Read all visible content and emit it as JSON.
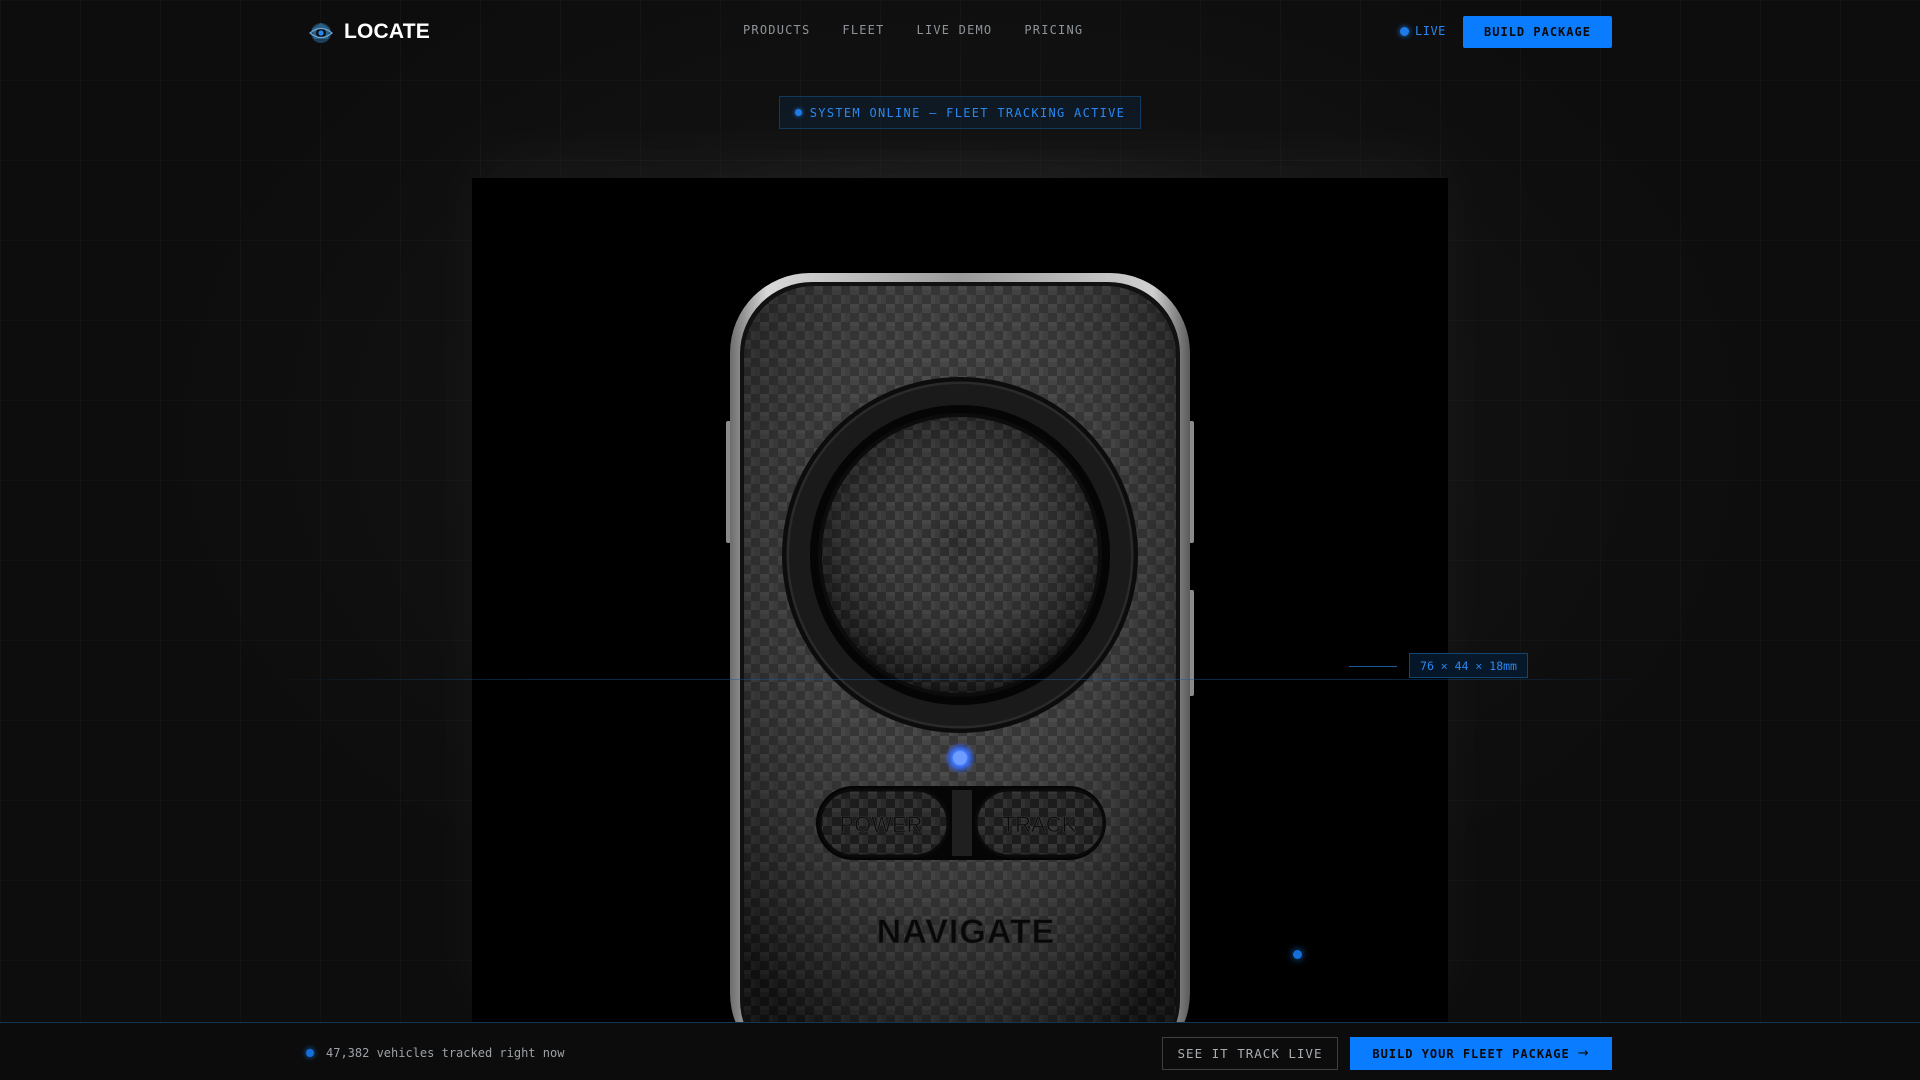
{
  "brand": {
    "name": "LOCATE",
    "logo_icon": "radar-eye-icon"
  },
  "nav": {
    "links": [
      "PRODUCTS",
      "FLEET",
      "LIVE DEMO",
      "PRICING"
    ],
    "live_label": "LIVE",
    "build_button": "BUILD PACKAGE"
  },
  "status": {
    "text": "SYSTEM ONLINE — FLEET TRACKING ACTIVE"
  },
  "device": {
    "buttons": [
      "POWER",
      "TRACK"
    ],
    "brand_mark": "NAVIGATE",
    "dimensions_label": "76 × 44 × 18mm"
  },
  "footer": {
    "tracked_text": "47,382 vehicles tracked right now",
    "see_button": "SEE IT TRACK LIVE",
    "fleet_button": "BUILD YOUR FLEET PACKAGE",
    "fleet_button_icon": "arrow-right-icon"
  },
  "colors": {
    "accent": "#0A7CFF",
    "accent_text": "#2A87F0",
    "background": "#0D0D0D"
  }
}
